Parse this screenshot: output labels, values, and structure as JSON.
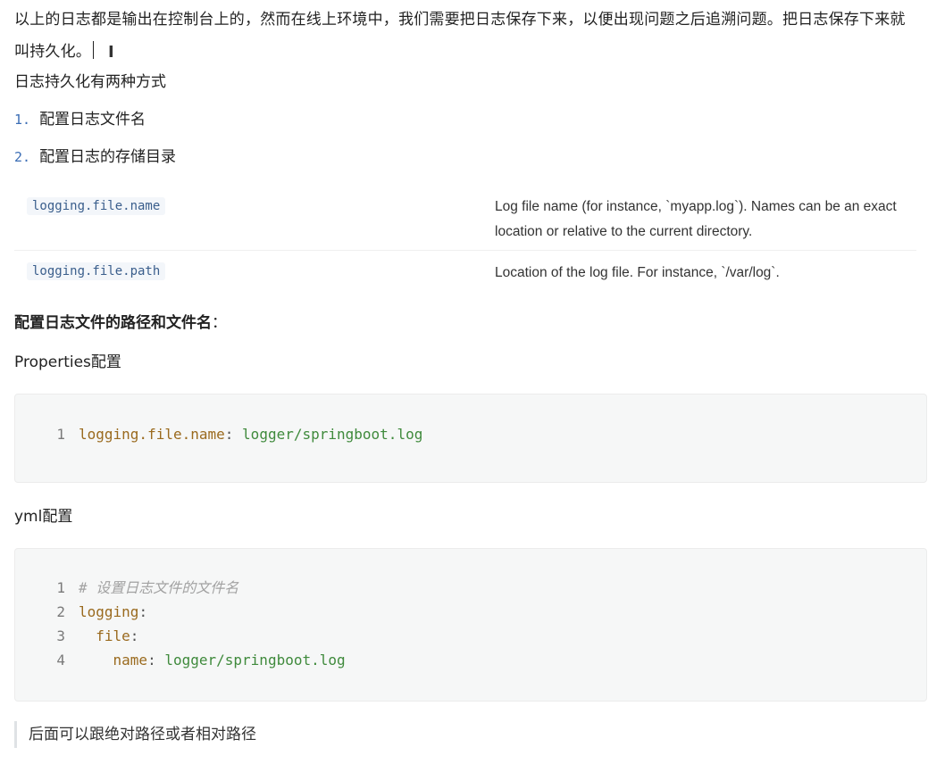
{
  "intro": {
    "text": "以上的日志都是输出在控制台上的，然而在线上环境中，我们需要把日志保存下来，以便出现问题之后追溯问题。把日志保存下来就叫持久化。",
    "cursor_glyph": "I"
  },
  "persist_intro": "日志持久化有两种方式",
  "ways": [
    {
      "num": "1.",
      "label": "配置日志文件名"
    },
    {
      "num": "2.",
      "label": "配置日志的存储目录"
    }
  ],
  "properties": [
    {
      "key": "logging.file.name",
      "description": "Log file name (for instance, `myapp.log`). Names can be an exact location or relative to the current directory."
    },
    {
      "key": "logging.file.path",
      "description": "Location of the log file. For instance, `/var/log`."
    }
  ],
  "section_heading": "配置日志文件的路径和文件名",
  "section_heading_colon": "：",
  "properties_label": "Properties配置",
  "properties_code": {
    "line_numbers": [
      "1"
    ],
    "key": "logging.file.name",
    "sep": ":",
    "value": "logger/springboot.log"
  },
  "yml_label": "yml配置",
  "yml_code": {
    "line_numbers": [
      "1",
      "2",
      "3",
      "4"
    ],
    "comment": "# 设置日志文件的文件名",
    "k1": "logging",
    "k2": "file",
    "k3": "name",
    "sep": ":",
    "value": "logger/springboot.log"
  },
  "note": "后面可以跟绝对路径或者相对路径",
  "colors": {
    "key": "#9a6a1e",
    "value": "#3f8a3c",
    "comment": "#a2a2a2",
    "list_number": "#3b6db5",
    "code_bg": "#f6f7f7",
    "inline_code": "#3a5e8c"
  }
}
